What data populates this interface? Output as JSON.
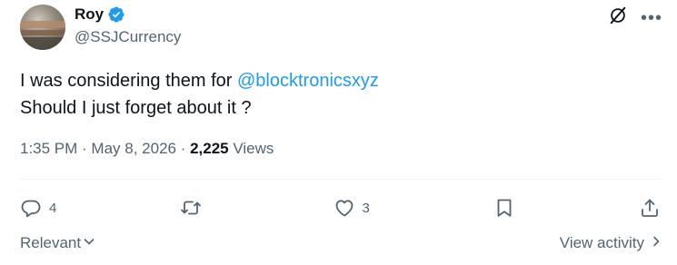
{
  "author": {
    "display_name": "Roy",
    "handle": "@SSJCurrency",
    "verified": true
  },
  "tweet": {
    "line1_text": "I was considering them for ",
    "line1_mention": "@blocktronicsxyz",
    "line2_text": "Should I just forget about it ?",
    "time": "1:35 PM",
    "separator": " · ",
    "date": "May 8, 2026",
    "views_count": "2,225",
    "views_label": " Views"
  },
  "actions": {
    "reply_count": "4",
    "retweet_count": "",
    "like_count": "3"
  },
  "footer": {
    "sort_label": "Relevant",
    "view_activity_label": "View activity"
  },
  "colors": {
    "accent": "#1d9bf0",
    "text_primary": "#0f1419",
    "text_secondary": "#536471"
  },
  "icons": [
    "verified-badge-icon",
    "grok-icon",
    "more-icon",
    "reply-icon",
    "retweet-icon",
    "like-icon",
    "bookmark-icon",
    "share-icon",
    "chevron-down-icon",
    "chevron-right-icon"
  ]
}
